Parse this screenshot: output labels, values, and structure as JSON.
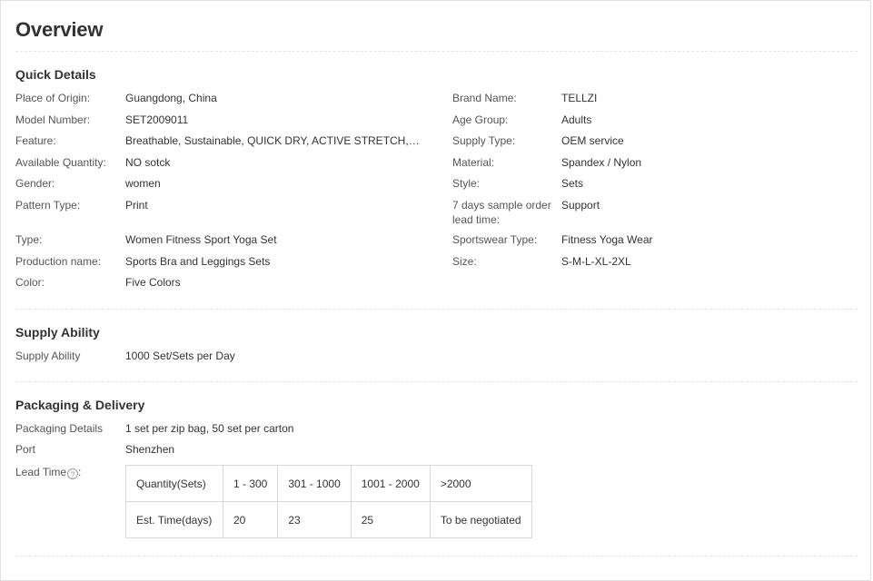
{
  "title": "Overview",
  "quick_details": {
    "heading": "Quick Details",
    "left": [
      {
        "label": "Place of Origin:",
        "value": "Guangdong, China"
      },
      {
        "label": "Model Number:",
        "value": "SET2009011"
      },
      {
        "label": "Feature:",
        "value": "Breathable, Sustainable, QUICK DRY, ACTIVE STRETCH, Swe..."
      },
      {
        "label": "Available Quantity:",
        "value": "NO sotck"
      },
      {
        "label": "Gender:",
        "value": "women"
      },
      {
        "label": "Pattern Type:",
        "value": "Print"
      },
      {
        "label": "Type:",
        "value": "Women Fitness Sport Yoga Set"
      },
      {
        "label": "Production name:",
        "value": "Sports Bra and Leggings Sets"
      },
      {
        "label": "Color:",
        "value": "Five Colors"
      }
    ],
    "right": [
      {
        "label": "Brand Name:",
        "value": "TELLZI"
      },
      {
        "label": "Age Group:",
        "value": "Adults"
      },
      {
        "label": "Supply Type:",
        "value": "OEM service"
      },
      {
        "label": "Material:",
        "value": "Spandex / Nylon"
      },
      {
        "label": "Style:",
        "value": "Sets"
      },
      {
        "label": "7 days sample order lead time:",
        "value": "Support"
      },
      {
        "label": "Sportswear Type:",
        "value": "Fitness Yoga Wear"
      },
      {
        "label": "Size:",
        "value": "S-M-L-XL-2XL"
      }
    ]
  },
  "supply_ability": {
    "heading": "Supply Ability",
    "label": "Supply Ability",
    "value": "1000 Set/Sets per Day"
  },
  "packaging": {
    "heading": "Packaging & Delivery",
    "details_label": "Packaging Details",
    "details_value": "1 set per zip bag, 50 set per carton",
    "port_label": "Port",
    "port_value": "Shenzhen",
    "lead_time_label": "Lead Time",
    "lead_time_suffix": ":",
    "help_icon": "question-circle-icon",
    "help_glyph": "?",
    "lead_table": {
      "row1": [
        "Quantity(Sets)",
        "1 - 300",
        "301 - 1000",
        "1001 - 2000",
        ">2000"
      ],
      "row2": [
        "Est. Time(days)",
        "20",
        "23",
        "25",
        "To be negotiated"
      ]
    }
  }
}
